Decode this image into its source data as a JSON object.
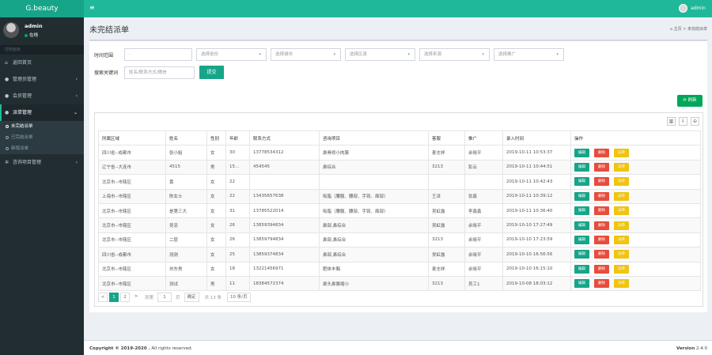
{
  "header": {
    "logo": "G.beauty",
    "menu_icon": "≡",
    "user": "admin"
  },
  "sidebar": {
    "user": "admin",
    "status": "在线",
    "nav_header": "控制面板",
    "items": [
      {
        "label": "返回首页",
        "icon": "home-icon"
      },
      {
        "label": "管理员管理",
        "icon": "users-icon"
      },
      {
        "label": "会员管理",
        "icon": "user-icon"
      },
      {
        "label": "派单管理",
        "icon": "user-icon"
      }
    ],
    "sub_items": [
      "未完结派单",
      "已完结派单",
      "新增派单"
    ],
    "after_items": [
      {
        "label": "咨询项目管理",
        "icon": "gear-icon"
      }
    ]
  },
  "page": {
    "title": "未完结派单",
    "breadcrumb_home": "主页",
    "breadcrumb_current": "未完结派单"
  },
  "filters": {
    "time_label": "时间范围",
    "time_value": "-",
    "selects": [
      "选择省份",
      "选择城市",
      "选择区县",
      "选择来源",
      "选择推广"
    ],
    "keyword_label": "搜索关键词",
    "keyword_placeholder": "姓名/联系方式/微信",
    "submit": "提交",
    "refresh": "刷新"
  },
  "table": {
    "columns": [
      "所属区域",
      "姓名",
      "性别",
      "年龄",
      "联系方式",
      "咨询项目",
      "客服",
      "推广",
      "录入时间",
      "操作"
    ],
    "ops": {
      "edit": "编辑",
      "delete": "删除",
      "dispatch": "派单"
    },
    "rows": [
      [
        "四川省--成都市",
        "张小姐",
        "女",
        "30",
        "13778534312",
        "鼻骨修小肉膜",
        "麦志祥",
        "余晓平",
        "2019-10-11 10:53:37"
      ],
      [
        "辽宁省--大连市",
        "4515",
        "男",
        "15…",
        "454545",
        "鼻综合",
        "3213",
        "彭云",
        "2019-10-11 10:44:51"
      ],
      [
        "北京市--市辖区",
        "黄",
        "女",
        "22",
        "",
        "",
        "",
        "",
        "2019-10-11 10:42:43"
      ],
      [
        "上海市--市辖区",
        "陈女士",
        "女",
        "22",
        "13435657638",
        "吸脂（腰腹、腰部、手臂、面部）",
        "王泽",
        "张鑫",
        "2019-10-11 10:39:12"
      ],
      [
        "北京市--市辖区",
        "是第三大",
        "女",
        "31",
        "13785522014",
        "吸脂（腰腹、腰部、手臂、面部）",
        "吴虹露",
        "李鑫鑫",
        "2019-10-11 10:36:40"
      ],
      [
        "北京市--市辖区",
        "吴忠",
        "女",
        "26",
        "13859394834",
        "鼻部,鼻综合",
        "吴虹露",
        "余晓平",
        "2019-10-10 17:27:49"
      ],
      [
        "北京市--市辖区",
        "二层",
        "女",
        "26",
        "13859794834",
        "鼻部,鼻综合",
        "3213",
        "余晓平",
        "2019-10-10 17:23:59"
      ],
      [
        "四川省--成都市",
        "测测",
        "女",
        "25",
        "13859374834",
        "鼻部,鼻综合",
        "吴虹露",
        "余晓平",
        "2019-10-10 16:56:56"
      ],
      [
        "北京市--市辖区",
        "刘东男",
        "女",
        "18",
        "13221456971",
        "肥体丰胸",
        "麦志祥",
        "余晓平",
        "2019-10-10 16:15:10"
      ],
      [
        "北京市--市辖区",
        "测试",
        "男",
        "11",
        "18384572374",
        "鼻头鼻翼缩小",
        "3213",
        "员工1",
        "2019-10-08 18:03:12"
      ]
    ]
  },
  "pager": {
    "prev": "<",
    "pages": [
      "1",
      "2"
    ],
    "next": ">",
    "goto": "到第",
    "page_unit": "页",
    "page_input": "1",
    "confirm": "确定",
    "total": "共 13 条",
    "size": "10 条/页"
  },
  "footer": {
    "copyright": "Copyright © 2019-2020 .",
    "rights": "All rights reserved.",
    "version_label": "Version",
    "version": "2.4.0"
  },
  "colors": {
    "brand": "#1fb89a",
    "sidebar": "#222d32",
    "edit": "#17a589",
    "delete": "#e74c3c",
    "dispatch": "#f1c40f"
  }
}
